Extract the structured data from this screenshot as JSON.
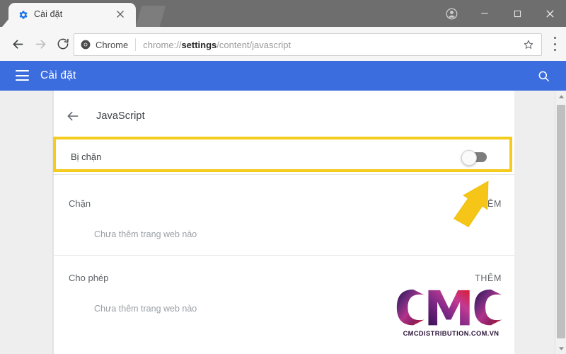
{
  "browser": {
    "tab": {
      "title": "Cài đặt",
      "favicon": "gear-icon",
      "close": "×"
    },
    "window_controls": {
      "profile": "profile-icon",
      "minimize": "−",
      "maximize": "□",
      "close": "✕"
    },
    "toolbar": {
      "back": "←",
      "forward": "→",
      "reload": "⟳",
      "chip_label": "Chrome",
      "url_prefix": "chrome://",
      "url_bold": "settings",
      "url_suffix": "/content/javascript",
      "bookmark": "☆",
      "menu": "⋮"
    }
  },
  "settings_header": {
    "menu_label": "hamburger-menu",
    "title": "Cài đặt",
    "search": "search-icon"
  },
  "page": {
    "back_label": "←",
    "title": "JavaScript",
    "toggle_row": {
      "label": "Bị chặn",
      "state": "off",
      "highlight_color": "#f5cb1e"
    },
    "sections": [
      {
        "heading": "Chặn",
        "add_label": "THÊM",
        "empty_text": "Chưa thêm trang web nào"
      },
      {
        "heading": "Cho phép",
        "add_label": "THÊM",
        "empty_text": "Chưa thêm trang web nào"
      }
    ]
  },
  "annotation": {
    "arrow_color": "#f5c518",
    "arrow_name": "pointer-arrow-to-toggle"
  },
  "watermark": {
    "logo_text": "CMC",
    "url_text": "CMCDISTRIBUTION.COM.VN"
  },
  "scrollbar": {
    "up": "▲",
    "down": "▼"
  }
}
